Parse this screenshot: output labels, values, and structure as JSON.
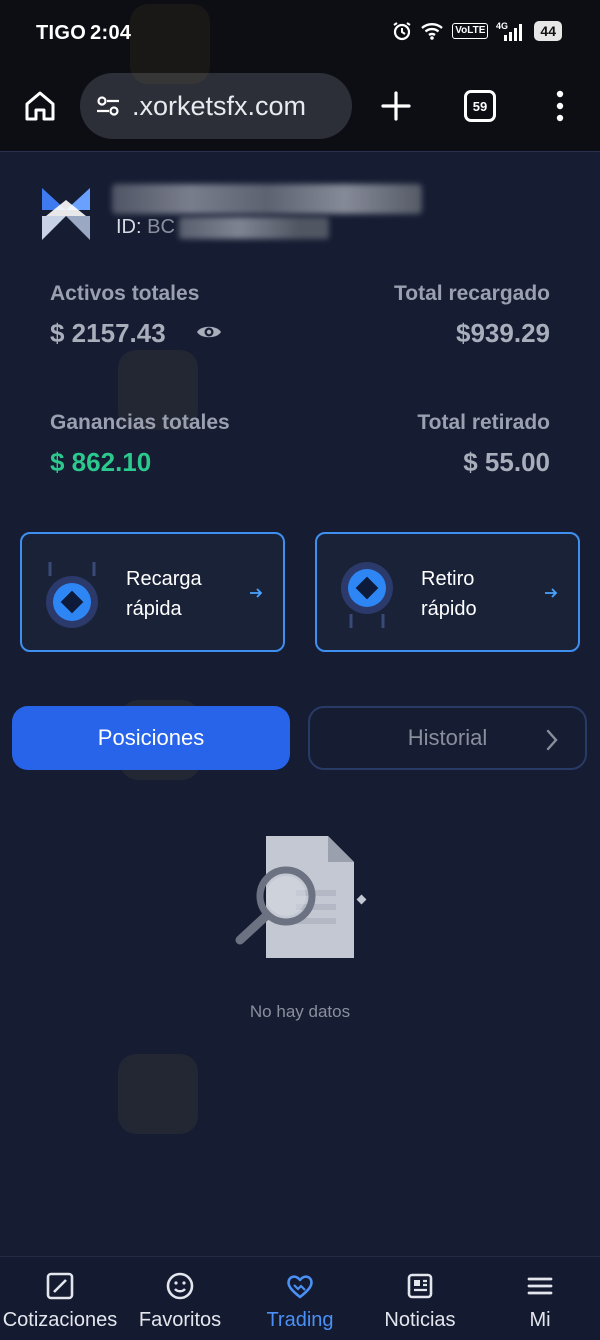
{
  "status_bar": {
    "carrier": "TIGO",
    "time": "2:04",
    "volte": "VoLTE",
    "network": "4G",
    "battery": "44"
  },
  "browser": {
    "url": "​.xorketsfx.com",
    "tab_count": "59"
  },
  "account": {
    "id_prefix": "ID:",
    "id_visible": "BC"
  },
  "stats": {
    "activos_label": "Activos totales",
    "activos_value": "$ 2157.43",
    "recargado_label": "Total recargado",
    "recargado_value": "$939.29",
    "ganancias_label": "Ganancias totales",
    "ganancias_value": "$ 862.10",
    "retirado_label": "Total retirado",
    "retirado_value": "$ 55.00"
  },
  "actions": {
    "recarga_l1": "Recarga",
    "recarga_l2": "rápida",
    "retiro_l1": "Retiro",
    "retiro_l2": "rápido"
  },
  "tabs": {
    "posiciones": "Posiciones",
    "historial": "Historial"
  },
  "empty": {
    "text": "No hay datos"
  },
  "nav": {
    "item1": "Cotizaciones",
    "item2": "Favoritos",
    "item3": "Trading",
    "item4": "Noticias",
    "item5": "Mi"
  },
  "colors": {
    "accent": "#2764ea",
    "card_border": "#3e8ff0",
    "positive": "#2bc98d",
    "active_nav": "#4a90f5"
  },
  "icons": [
    "home-icon",
    "tune-icon",
    "plus-icon",
    "more-vert-icon",
    "eye-icon",
    "arrow-right-icon",
    "chevron-right-icon",
    "search-doc-icon",
    "chart-icon",
    "smiley-icon",
    "handshake-icon",
    "newspaper-icon",
    "menu-icon"
  ]
}
